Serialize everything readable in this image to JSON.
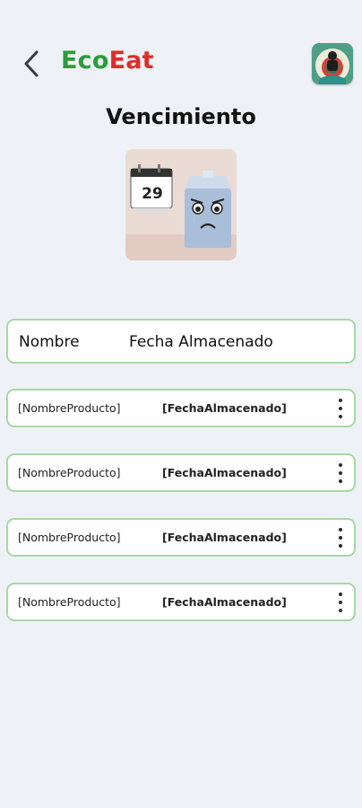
{
  "header": {
    "brand_part1": "Eco",
    "brand_part2": "Eat",
    "brand_colors": {
      "eco": "#2e9c3c",
      "eat": "#e12b2b"
    },
    "back_icon": "chevron-left-icon",
    "avatar_icon": "user-avatar-icon"
  },
  "page": {
    "title": "Vencimiento",
    "illustration": "expired-milk-calendar-illustration",
    "calendar_number": "29"
  },
  "table": {
    "columns": [
      "Nombre",
      "Fecha Almacenado"
    ],
    "rows": [
      {
        "name": "[NombreProducto]",
        "date": "[FechaAlmacenado]"
      },
      {
        "name": "[NombreProducto]",
        "date": "[FechaAlmacenado]"
      },
      {
        "name": "[NombreProducto]",
        "date": "[FechaAlmacenado]"
      },
      {
        "name": "[NombreProducto]",
        "date": "[FechaAlmacenado]"
      }
    ],
    "row_menu_icon": "kebab-menu-icon"
  },
  "colors": {
    "background": "#eef2f6",
    "card_border": "#a7d8a5"
  }
}
